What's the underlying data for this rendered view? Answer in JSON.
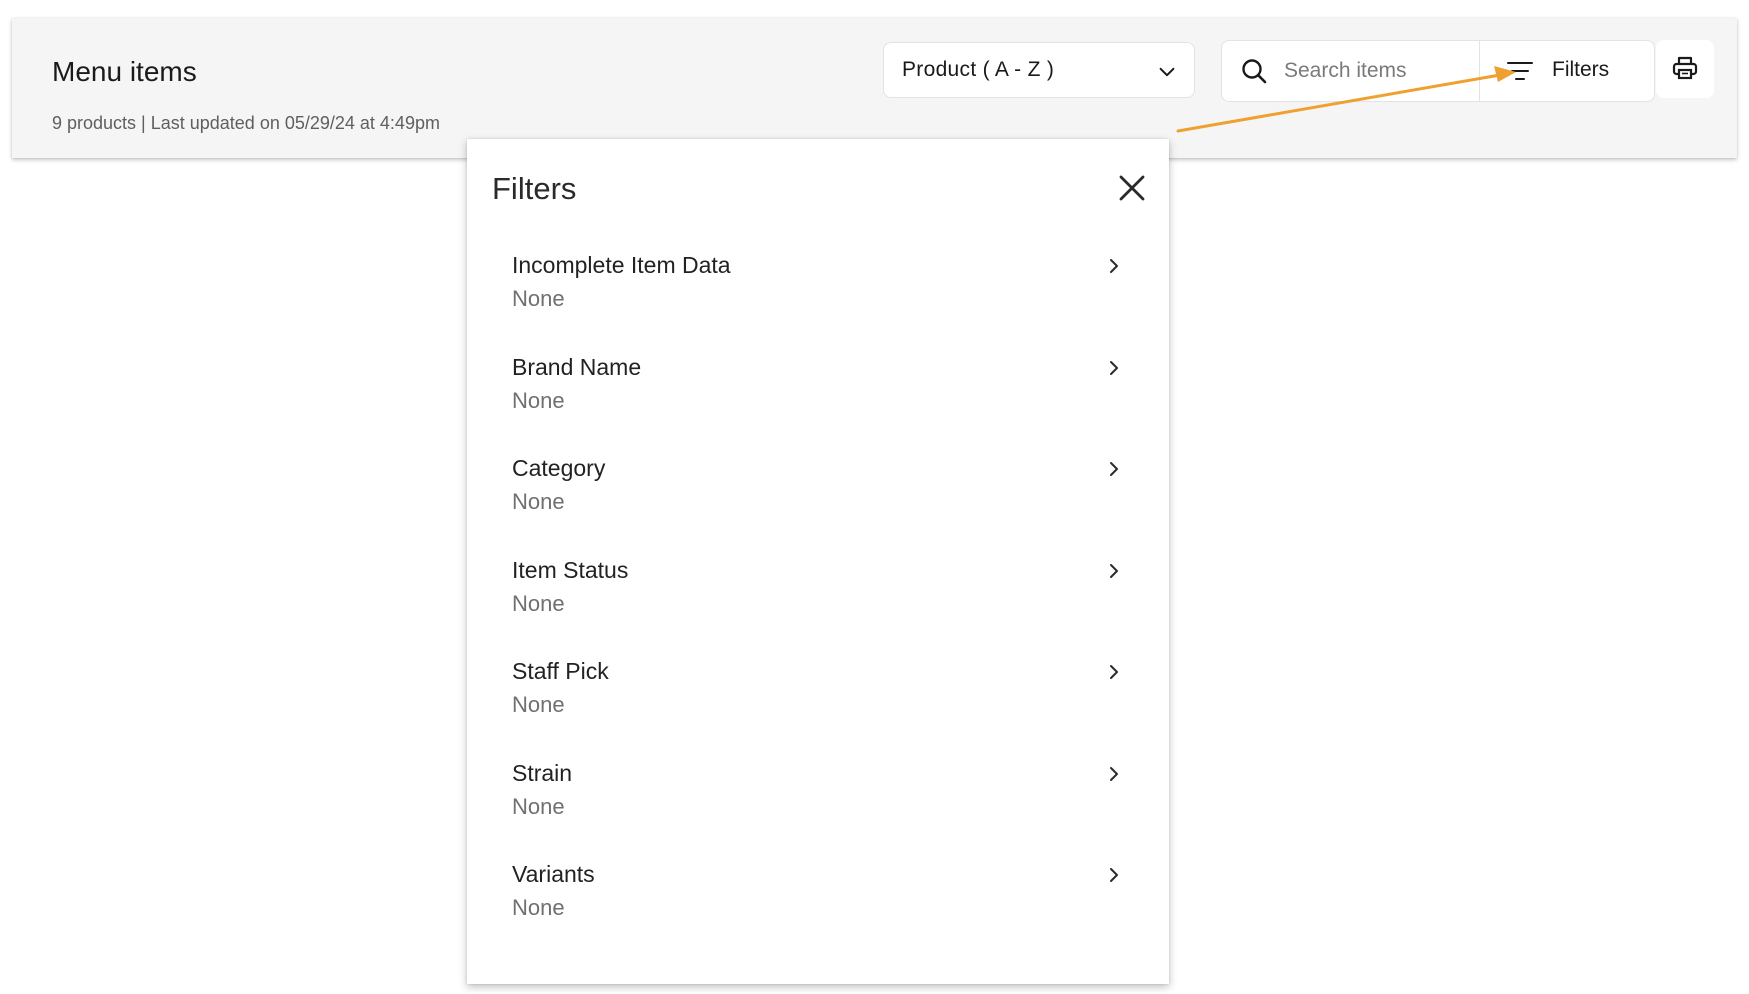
{
  "header": {
    "title": "Menu items",
    "subtitle": "9 products | Last updated on 05/29/24 at 4:49pm"
  },
  "sort": {
    "selected": "Product ( A - Z )"
  },
  "search": {
    "placeholder": "Search items",
    "value": ""
  },
  "toolbar": {
    "filters_label": "Filters"
  },
  "icons": {
    "sort": "chevron-down-icon",
    "search": "search-icon",
    "filters": "filter-lines-icon",
    "print": "printer-icon",
    "close": "close-icon",
    "item": "chevron-right-icon"
  },
  "colors": {
    "annotation_arrow": "#f0a030",
    "topbar_bg": "#f5f5f5"
  },
  "filters_panel": {
    "title": "Filters",
    "items": [
      {
        "name": "Incomplete Item Data",
        "value": "None"
      },
      {
        "name": "Brand Name",
        "value": "None"
      },
      {
        "name": "Category",
        "value": "None"
      },
      {
        "name": "Item Status",
        "value": "None"
      },
      {
        "name": "Staff Pick",
        "value": "None"
      },
      {
        "name": "Strain",
        "value": "None"
      },
      {
        "name": "Variants",
        "value": "None"
      }
    ]
  }
}
